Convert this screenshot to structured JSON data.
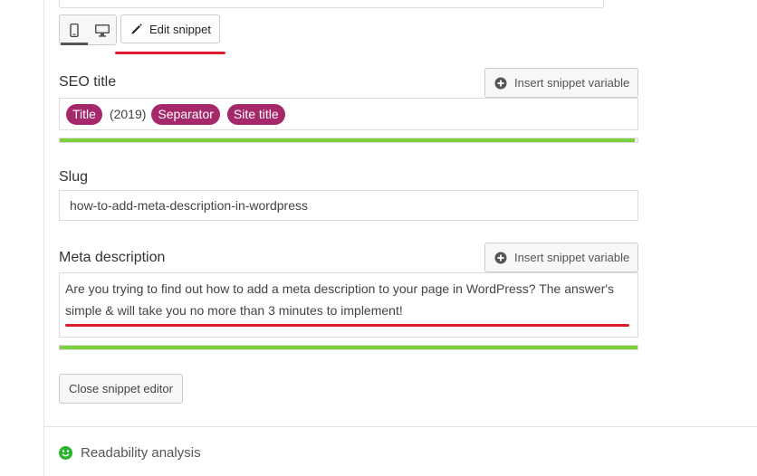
{
  "toolbar": {
    "mobile_icon": "mobile-phone-icon",
    "desktop_icon": "desktop-monitor-icon",
    "edit_snippet_label": "Edit snippet",
    "edit_icon": "pencil-icon"
  },
  "seo_title": {
    "label": "SEO title",
    "insert_variable_label": "Insert snippet variable",
    "parts": [
      {
        "type": "pill",
        "text": "Title"
      },
      {
        "type": "text",
        "text": "(2019)"
      },
      {
        "type": "pill",
        "text": "Separator"
      },
      {
        "type": "pill",
        "text": "Site title"
      }
    ],
    "progress": 0.995
  },
  "slug": {
    "label": "Slug",
    "value": "how-to-add-meta-description-in-wordpress"
  },
  "meta_description": {
    "label": "Meta description",
    "insert_variable_label": "Insert snippet variable",
    "value": "Are you trying to find out how to add a meta description to your page in WordPress? The answer's simple & will take you no more than 3 minutes to implement!",
    "progress": 1.0
  },
  "close_button_label": "Close snippet editor",
  "readability": {
    "label": "Readability analysis",
    "status": "good",
    "icon": "smiley-face-icon"
  },
  "colors": {
    "pill": "#a4286a",
    "progress_good": "#7ad03a",
    "annotation_red": "#dc1d2b",
    "status_good": "#2cb32c"
  }
}
